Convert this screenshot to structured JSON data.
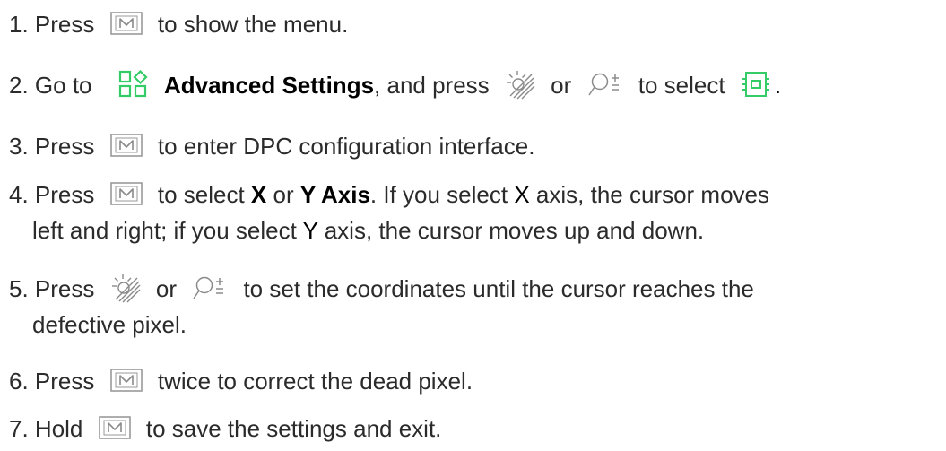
{
  "steps": [
    {
      "num": "1.",
      "pre": "Press",
      "post": "to show the menu."
    },
    {
      "num": "2.",
      "pre": "Go to",
      "menu_label": "Advanced Settings",
      "mid1": ", and press",
      "mid2": "or",
      "mid3": "to select",
      "end": "."
    },
    {
      "num": "3.",
      "pre": "Press",
      "post": "to enter DPC configuration interface."
    },
    {
      "num": "4.",
      "pre": "Press",
      "mid1": "to select",
      "x": "X",
      "or": "or",
      "y_axis": "Y Axis",
      "mid2": ". If you select",
      "x2": "X",
      "line1_end": "axis, the cursor moves",
      "line2a": "left and right; if you select",
      "y2": "Y",
      "line2b": "axis, the cursor moves up and down."
    },
    {
      "num": "5.",
      "pre": "Press",
      "mid1": "or",
      "line1_end": "to set the coordinates until the cursor reaches the",
      "line2": "defective pixel."
    },
    {
      "num": "6.",
      "pre": "Press",
      "post": "twice to correct the dead pixel."
    },
    {
      "num": "7.",
      "pre": "Hold",
      "post": "to save the settings and exit."
    }
  ],
  "icons": {
    "menu_key": "m-key-icon",
    "advanced_settings": "advanced-settings-icon",
    "brightness": "brightness-icon",
    "zoom": "zoom-icon",
    "dpc": "dpc-icon"
  },
  "colors": {
    "text": "#2b2b2b",
    "accent": "#33cc66",
    "key_border": "#9a9a9a"
  }
}
